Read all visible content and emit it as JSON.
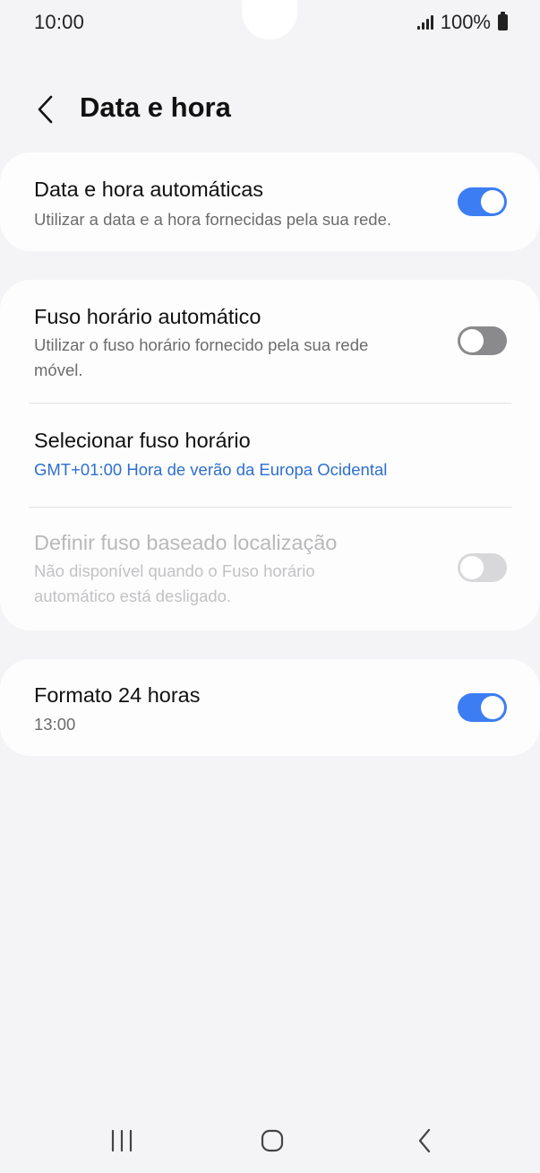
{
  "status_bar": {
    "time": "10:00",
    "battery": "100%",
    "signal_icon": "signal-bars-icon",
    "battery_icon": "battery-icon"
  },
  "header": {
    "title": "Data e hora",
    "back_icon": "chevron-left-icon"
  },
  "settings": {
    "auto_datetime": {
      "title": "Data e hora automáticas",
      "subtitle": "Utilizar a data e a hora fornecidas pela sua rede.",
      "enabled": true
    },
    "auto_timezone": {
      "title": "Fuso horário automático",
      "subtitle_line1": "Utilizar o fuso horário fornecido pela sua rede",
      "subtitle_line2": "móvel.",
      "enabled": false
    },
    "select_timezone": {
      "title": "Selecionar fuso horário",
      "value": "GMT+01:00 Hora de verão da Europa Ocidental"
    },
    "location_timezone": {
      "title": "Definir fuso baseado localização",
      "subtitle_line1": "Não disponível quando o Fuso horário",
      "subtitle_line2": "automático está desligado.",
      "enabled": false,
      "disabled": true
    },
    "format_24h": {
      "title": "Formato 24 horas",
      "subtitle": "13:00",
      "enabled": true
    }
  },
  "colors": {
    "accent": "#3c7df3",
    "link": "#2e6fd0",
    "background": "#f4f4f6",
    "card": "#fdfdfe"
  },
  "nav_bar": {
    "recents_icon": "recents-icon",
    "home_icon": "home-icon",
    "back_icon": "back-icon"
  }
}
